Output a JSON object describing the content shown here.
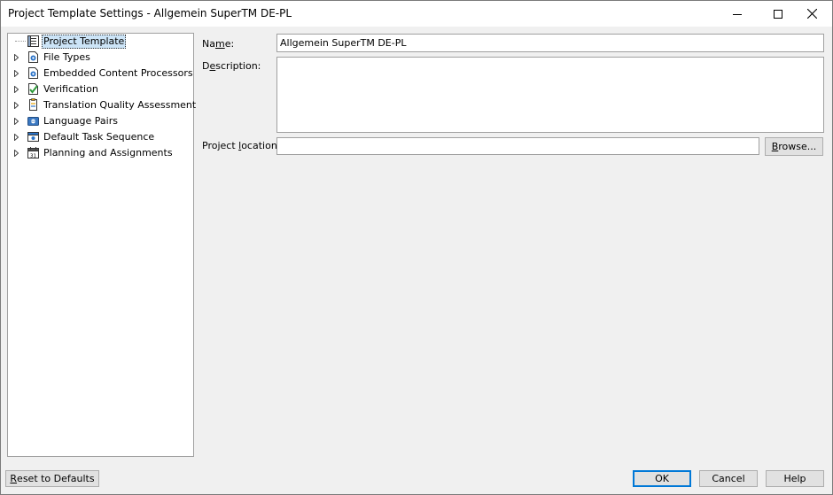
{
  "window": {
    "title": "Project Template Settings - Allgemein SuperTM DE-PL"
  },
  "tree": {
    "items": [
      {
        "label": "Project Template",
        "icon": "project-template-icon",
        "expandable": false,
        "selected": true
      },
      {
        "label": "File Types",
        "icon": "file-types-icon",
        "expandable": true
      },
      {
        "label": "Embedded Content Processors",
        "icon": "embedded-content-icon",
        "expandable": true
      },
      {
        "label": "Verification",
        "icon": "verification-icon",
        "expandable": true
      },
      {
        "label": "Translation Quality Assessment",
        "icon": "tqa-icon",
        "expandable": true
      },
      {
        "label": "Language Pairs",
        "icon": "language-pairs-icon",
        "expandable": true
      },
      {
        "label": "Default Task Sequence",
        "icon": "task-sequence-icon",
        "expandable": true
      },
      {
        "label": "Planning and Assignments",
        "icon": "calendar-icon",
        "expandable": true
      }
    ]
  },
  "form": {
    "name_label_pre": "Na",
    "name_label_key": "m",
    "name_label_post": "e:",
    "name_value": "Allgemein SuperTM DE-PL",
    "description_label_pre": "D",
    "description_label_key": "e",
    "description_label_post": "scription:",
    "description_value": "",
    "location_label_pre": "Project ",
    "location_label_key": "l",
    "location_label_post": "ocation:",
    "location_value": "",
    "browse_key": "B",
    "browse_rest": "rowse..."
  },
  "footer": {
    "reset_key": "R",
    "reset_rest": "eset to Defaults",
    "ok_label": "OK",
    "cancel_label": "Cancel",
    "help_label": "Help"
  },
  "colors": {
    "selection": "#cce4f7",
    "default_button_border": "#0078d7"
  }
}
